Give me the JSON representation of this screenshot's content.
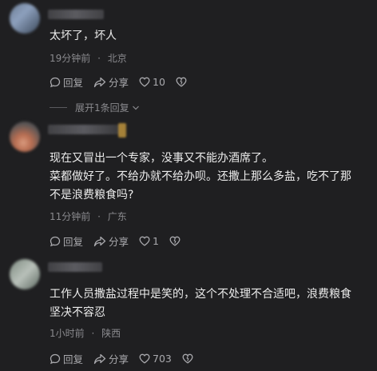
{
  "comments": [
    {
      "text": "太坏了，坏人",
      "time": "19分钟前",
      "location": "北京",
      "reply_label": "回复",
      "share_label": "分享",
      "likes": "10",
      "expand_label": "展开1条回复"
    },
    {
      "text": "现在又冒出一个专家，没事又不能办酒席了。\n菜都做好了。不给办就不给办呗。还撒上那么多盐，吃不了那\n不是浪费粮食吗?",
      "time": "11分钟前",
      "location": "广东",
      "reply_label": "回复",
      "share_label": "分享",
      "likes": "1"
    },
    {
      "text": "工作人员撒盐过程中是笑的，这个不处理不合适吧，浪费粮食\n坚决不容忍",
      "time": "1小时前",
      "location": "陕西",
      "reply_label": "回复",
      "share_label": "分享",
      "likes": "703"
    }
  ],
  "meta_separator": "·",
  "icons": {
    "reply": "reply-bubble-icon",
    "share": "share-arrow-icon",
    "like": "heart-icon",
    "dislike": "broken-heart-icon",
    "expand": "chevron-down-icon"
  },
  "colors": {
    "background": "#1f1f21",
    "text": "#ececec",
    "meta": "#8a8a8e"
  }
}
